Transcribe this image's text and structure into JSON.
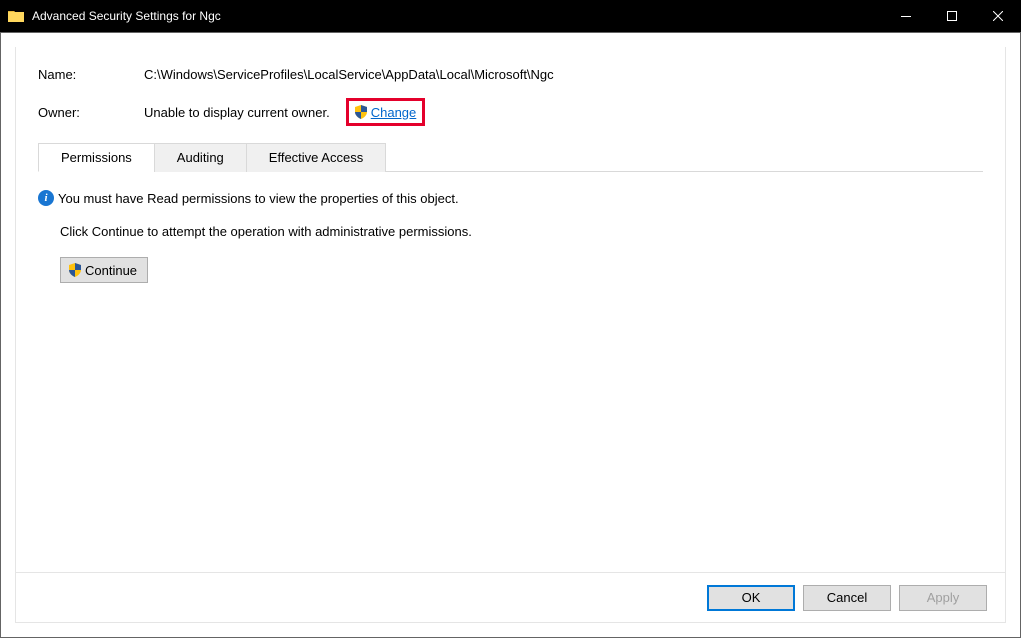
{
  "titlebar": {
    "title": "Advanced Security Settings for Ngc"
  },
  "fields": {
    "name_label": "Name:",
    "name_value": "C:\\Windows\\ServiceProfiles\\LocalService\\AppData\\Local\\Microsoft\\Ngc",
    "owner_label": "Owner:",
    "owner_value": "Unable to display current owner.",
    "change_link": "Change"
  },
  "tabs": {
    "permissions": "Permissions",
    "auditing": "Auditing",
    "effective": "Effective Access"
  },
  "messages": {
    "info": "You must have Read permissions to view the properties of this object.",
    "instruction": "Click Continue to attempt the operation with administrative permissions."
  },
  "buttons": {
    "continue": "Continue",
    "ok": "OK",
    "cancel": "Cancel",
    "apply": "Apply"
  }
}
